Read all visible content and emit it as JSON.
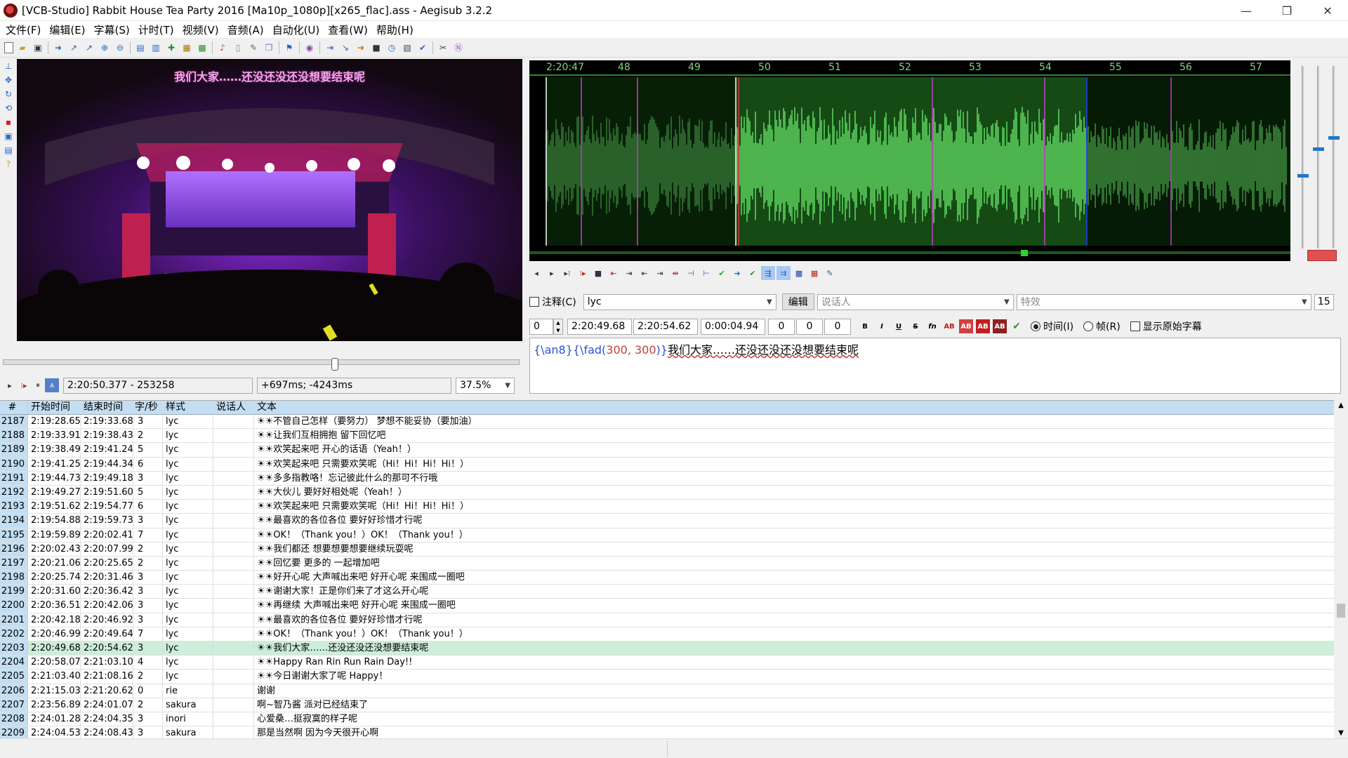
{
  "window": {
    "title": "[VCB-Studio] Rabbit House Tea Party 2016 [Ma10p_1080p][x265_flac].ass - Aegisub 3.2.2",
    "minimize_glyph": "—",
    "maximize_glyph": "❐",
    "close_glyph": "✕"
  },
  "menu": [
    "文件(F)",
    "编辑(E)",
    "字幕(S)",
    "计时(T)",
    "视频(V)",
    "音频(A)",
    "自动化(U)",
    "查看(W)",
    "帮助(H)"
  ],
  "video": {
    "subtitle_overlay": "我们大家……还没还没还没想要结束呢",
    "time_field": "2:20:50.377 - 253258",
    "offset_field": "+697ms; -4243ms",
    "zoom": "37.5%",
    "seek_position": 0.64
  },
  "audio": {
    "ruler_labels": [
      "2:20:47",
      "48",
      "49",
      "50",
      "51",
      "52",
      "53",
      "54",
      "55",
      "56",
      "57"
    ],
    "colors": {
      "selection": "#5ccf5c",
      "waveform_dim": "#1f8f1f",
      "marker": "#c040c0",
      "keyframe": "#2040ff"
    }
  },
  "editor": {
    "comment_label": "注释(C)",
    "style_value": "lyc",
    "edit_button": "编辑",
    "actor_placeholder": "说话人",
    "effect_placeholder": "特效",
    "effect_count": "15",
    "layer": "0",
    "start_time": "2:20:49.68",
    "end_time": "2:20:54.62",
    "duration": "0:00:04.94",
    "margin_l": "0",
    "margin_r": "0",
    "margin_v": "0",
    "bold": "B",
    "italic": "I",
    "underline": "U",
    "strike": "S",
    "fn": "fn",
    "time_radio": "时间(I)",
    "frame_radio": "帧(R)",
    "show_original": "显示原始字幕",
    "text_tag_open": "{\\an8}{\\fad(",
    "text_tag_args": "300, 300",
    "text_tag_close": ")}",
    "text_body": "我们大家……还没还没还没想要结束呢"
  },
  "grid": {
    "headers": {
      "num": "#",
      "start": "开始时间",
      "end": "结束时间",
      "cps": "字/秒",
      "style": "样式",
      "actor": "说话人",
      "text": "文本"
    },
    "rows": [
      {
        "num": "2187",
        "start": "2:19:28.65",
        "end": "2:19:33.68",
        "cps": "3",
        "style": "lyc",
        "actor": "",
        "text": "☀☀不管自己怎样（要努力） 梦想不能妥协（要加油）"
      },
      {
        "num": "2188",
        "start": "2:19:33.91",
        "end": "2:19:38.43",
        "cps": "2",
        "style": "lyc",
        "actor": "",
        "text": "☀☀让我们互相拥抱 留下回忆吧"
      },
      {
        "num": "2189",
        "start": "2:19:38.49",
        "end": "2:19:41.24",
        "cps": "5",
        "style": "lyc",
        "actor": "",
        "text": "☀☀欢笑起来吧 开心的话语（Yeah！）"
      },
      {
        "num": "2190",
        "start": "2:19:41.25",
        "end": "2:19:44.34",
        "cps": "6",
        "style": "lyc",
        "actor": "",
        "text": "☀☀欢笑起来吧 只需要欢笑呢（Hi！Hi！Hi！Hi！）"
      },
      {
        "num": "2191",
        "start": "2:19:44.73",
        "end": "2:19:49.18",
        "cps": "3",
        "style": "lyc",
        "actor": "",
        "text": "☀☀多多指教咯！忘记彼此什么的那可不行哦"
      },
      {
        "num": "2192",
        "start": "2:19:49.27",
        "end": "2:19:51.60",
        "cps": "5",
        "style": "lyc",
        "actor": "",
        "text": "☀☀大伙儿 要好好相处呢（Yeah！）"
      },
      {
        "num": "2193",
        "start": "2:19:51.62",
        "end": "2:19:54.77",
        "cps": "6",
        "style": "lyc",
        "actor": "",
        "text": "☀☀欢笑起来吧 只需要欢笑呢（Hi！Hi！Hi！Hi！）"
      },
      {
        "num": "2194",
        "start": "2:19:54.88",
        "end": "2:19:59.73",
        "cps": "3",
        "style": "lyc",
        "actor": "",
        "text": "☀☀最喜欢的各位各位 要好好珍惜才行呢"
      },
      {
        "num": "2195",
        "start": "2:19:59.89",
        "end": "2:20:02.41",
        "cps": "7",
        "style": "lyc",
        "actor": "",
        "text": "☀☀OK！（Thank you！）OK！（Thank you！）"
      },
      {
        "num": "2196",
        "start": "2:20:02.43",
        "end": "2:20:07.99",
        "cps": "2",
        "style": "lyc",
        "actor": "",
        "text": "☀☀我们都还 想要想要想要继续玩耍呢"
      },
      {
        "num": "2197",
        "start": "2:20:21.06",
        "end": "2:20:25.65",
        "cps": "2",
        "style": "lyc",
        "actor": "",
        "text": "☀☀回忆要 更多的 一起增加吧"
      },
      {
        "num": "2198",
        "start": "2:20:25.74",
        "end": "2:20:31.46",
        "cps": "3",
        "style": "lyc",
        "actor": "",
        "text": "☀☀好开心呢 大声喊出来吧 好开心呢 来围成一圈吧"
      },
      {
        "num": "2199",
        "start": "2:20:31.60",
        "end": "2:20:36.42",
        "cps": "3",
        "style": "lyc",
        "actor": "",
        "text": "☀☀谢谢大家！正是你们来了才这么开心呢"
      },
      {
        "num": "2200",
        "start": "2:20:36.51",
        "end": "2:20:42.06",
        "cps": "3",
        "style": "lyc",
        "actor": "",
        "text": "☀☀再继续 大声喊出来吧 好开心呢 来围成一圈吧"
      },
      {
        "num": "2201",
        "start": "2:20:42.18",
        "end": "2:20:46.92",
        "cps": "3",
        "style": "lyc",
        "actor": "",
        "text": "☀☀最喜欢的各位各位 要好好珍惜才行呢"
      },
      {
        "num": "2202",
        "start": "2:20:46.99",
        "end": "2:20:49.64",
        "cps": "7",
        "style": "lyc",
        "actor": "",
        "text": "☀☀OK！（Thank you！）OK！（Thank you！）"
      },
      {
        "num": "2203",
        "start": "2:20:49.68",
        "end": "2:20:54.62",
        "cps": "3",
        "style": "lyc",
        "actor": "",
        "text": "☀☀我们大家……还没还没还没想要结束呢",
        "active": true
      },
      {
        "num": "2204",
        "start": "2:20:58.07",
        "end": "2:21:03.10",
        "cps": "4",
        "style": "lyc",
        "actor": "",
        "text": "☀☀Happy Ran Rin Run Rain Day!!"
      },
      {
        "num": "2205",
        "start": "2:21:03.40",
        "end": "2:21:08.16",
        "cps": "2",
        "style": "lyc",
        "actor": "",
        "text": "☀☀今日谢谢大家了呢  Happy！"
      },
      {
        "num": "2206",
        "start": "2:21:15.03",
        "end": "2:21:20.62",
        "cps": "0",
        "style": "rie",
        "actor": "",
        "text": "谢谢"
      },
      {
        "num": "2207",
        "start": "2:23:56.89",
        "end": "2:24:01.07",
        "cps": "2",
        "style": "sakura",
        "actor": "",
        "text": "啊~智乃酱 派对已经结束了"
      },
      {
        "num": "2208",
        "start": "2:24:01.28",
        "end": "2:24:04.35",
        "cps": "3",
        "style": "inori",
        "actor": "",
        "text": "心爱桑…挺寂寞的样子呢"
      },
      {
        "num": "2209",
        "start": "2:24:04.53",
        "end": "2:24:08.43",
        "cps": "3",
        "style": "sakura",
        "actor": "",
        "text": "那是当然啊 因为今天很开心啊"
      }
    ]
  }
}
